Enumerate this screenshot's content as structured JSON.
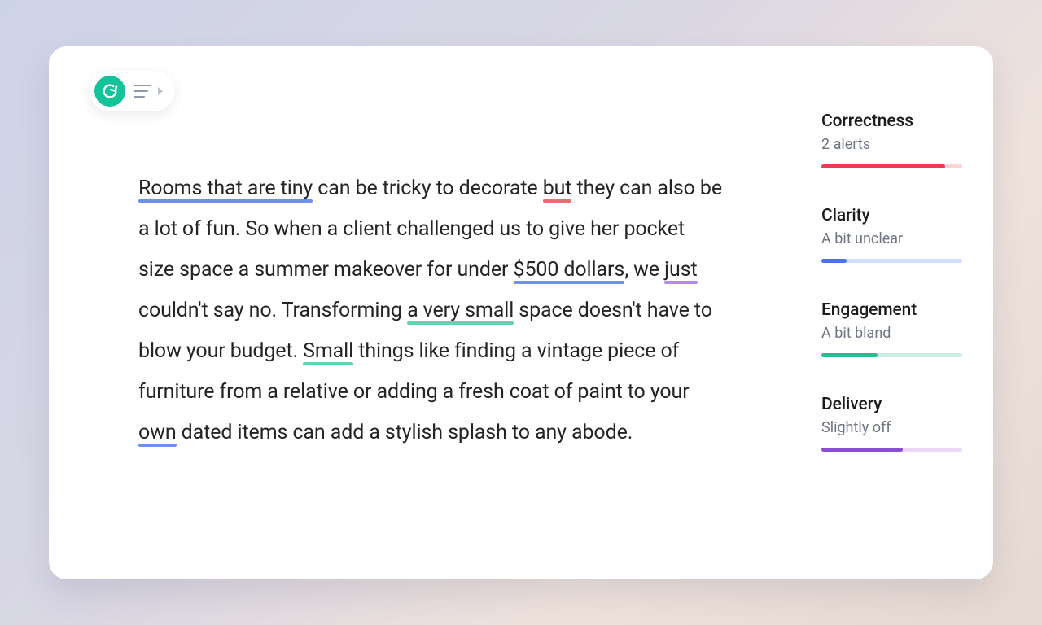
{
  "toolbar": {
    "logo_letter": "G"
  },
  "document": {
    "segments": [
      {
        "text": "Rooms that are tiny",
        "underline": "blue"
      },
      {
        "text": " can be tricky to decorate "
      },
      {
        "text": "but",
        "underline": "red"
      },
      {
        "text": " they can also be a lot of fun.  So when a client challenged us to give her "
      },
      {
        "text": "pocket size",
        "underline": "red"
      },
      {
        "text": " space a summer makeover for under "
      },
      {
        "text": "$500 dollars",
        "underline": "blue"
      },
      {
        "text": ", we "
      },
      {
        "text": "just",
        "underline": "purple"
      },
      {
        "text": " couldn't say no. Transforming "
      },
      {
        "text": "a very small",
        "underline": "teal"
      },
      {
        "text": " space doesn't have to blow your budget. "
      },
      {
        "text": "Small",
        "underline": "teal"
      },
      {
        "text": " things like finding a vintage piece of furniture from a relative or adding a fresh coat of paint to your "
      },
      {
        "text": "own",
        "underline": "blue"
      },
      {
        "text": " dated items can add a stylish splash to any abode."
      }
    ]
  },
  "colors": {
    "blue": "#6f8ff0",
    "red": "#ef6a77",
    "teal": "#5fd4b0",
    "purple": "#b18be6",
    "red_bar": {
      "track": "#fbd4d7",
      "fill": "#ec3b55",
      "percent": 88
    },
    "blue_bar": {
      "track": "#cfe0fb",
      "fill": "#4a72e5",
      "percent": 18
    },
    "teal_bar": {
      "track": "#c8efe2",
      "fill": "#1fbf92",
      "percent": 40
    },
    "purple_bar": {
      "track": "#ecd9f6",
      "fill": "#8a4fd1",
      "percent": 58
    }
  },
  "metrics": [
    {
      "id": "correctness",
      "title": "Correctness",
      "subtitle": "2 alerts",
      "bar": "red_bar"
    },
    {
      "id": "clarity",
      "title": "Clarity",
      "subtitle": "A bit unclear",
      "bar": "blue_bar"
    },
    {
      "id": "engagement",
      "title": "Engagement",
      "subtitle": "A bit bland",
      "bar": "teal_bar"
    },
    {
      "id": "delivery",
      "title": "Delivery",
      "subtitle": "Slightly off",
      "bar": "purple_bar"
    }
  ]
}
